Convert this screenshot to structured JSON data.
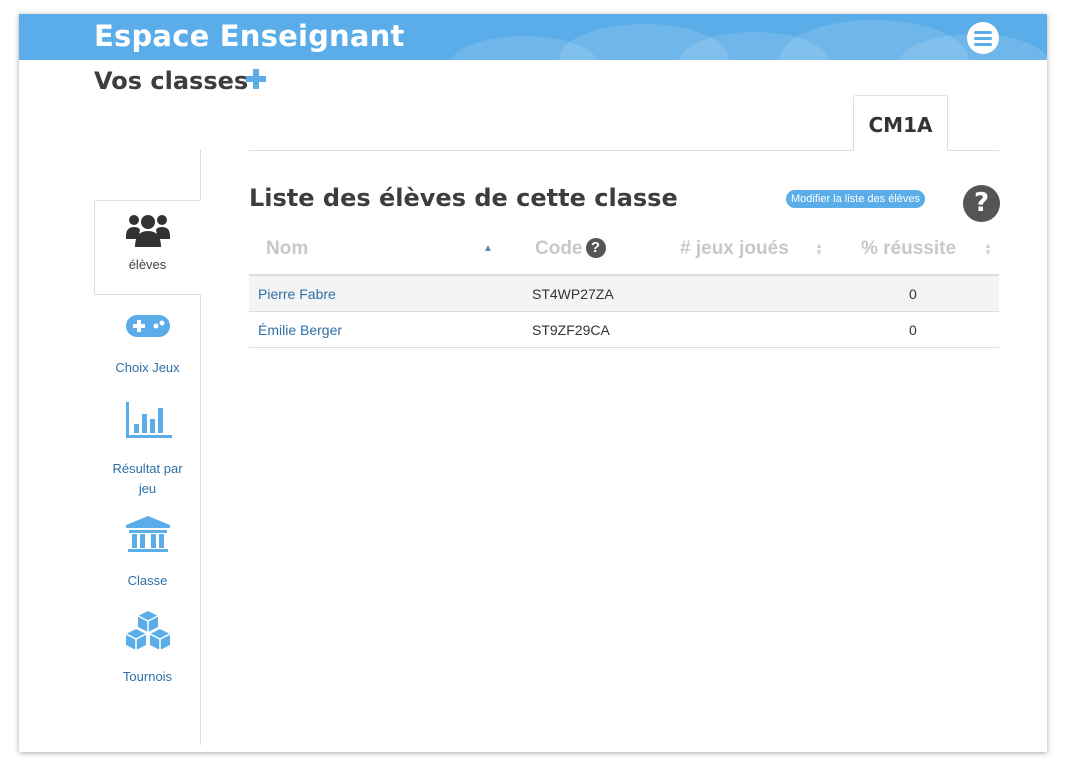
{
  "header": {
    "title": "Espace Enseignant",
    "menu_icon": "hamburger-menu-icon",
    "color": "#5aade8"
  },
  "classes": {
    "title": "Vos classes",
    "add_icon": "plus-icon",
    "tabs": [
      {
        "label": "CM1A",
        "active": true
      }
    ]
  },
  "sidebar": {
    "items": [
      {
        "label": "élèves",
        "icon": "users-icon",
        "active": true
      },
      {
        "label": "Choix Jeux",
        "icon": "gamepad-icon",
        "active": false
      },
      {
        "label": "Résultat par jeu",
        "icon": "bar-chart-icon",
        "active": false
      },
      {
        "label": "Classe",
        "icon": "institution-icon",
        "active": false
      },
      {
        "label": "Tournois",
        "icon": "cubes-icon",
        "active": false
      }
    ]
  },
  "main": {
    "title": "Liste des élèves de cette classe",
    "edit_button": "Modifier la liste des élèves",
    "help_icon": "question-circle-icon",
    "table": {
      "columns": [
        "Nom",
        "Code",
        "# jeux joués",
        "% réussite"
      ],
      "sort_column": "Nom",
      "rows": [
        {
          "name": "Pierre Fabre",
          "code": "ST4WP27ZA",
          "jeux": "",
          "reussite": "0"
        },
        {
          "name": "Émilie Berger",
          "code": "ST9ZF29CA",
          "jeux": "",
          "reussite": "0"
        }
      ]
    }
  }
}
